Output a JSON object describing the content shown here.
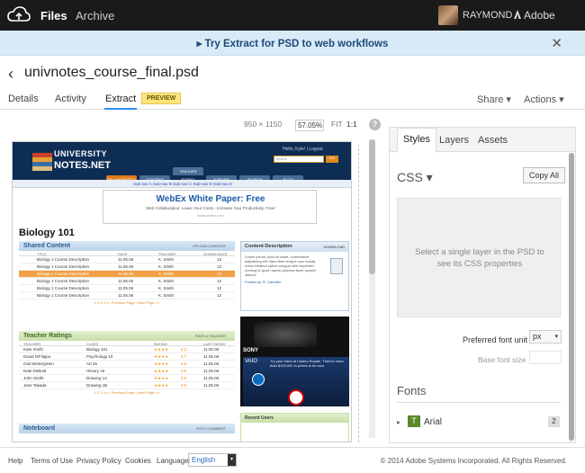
{
  "topbar": {
    "files": "Files",
    "archive": "Archive",
    "user": "RAYMOND",
    "brand": "Adobe"
  },
  "promo": {
    "text": "▸ Try Extract for PSD to web workflows",
    "close": "✕"
  },
  "file": {
    "back": "‹",
    "name": "univnotes_course_final.psd"
  },
  "tabs": {
    "details": "Details",
    "activity": "Activity",
    "extract": "Extract",
    "preview": "PREVIEW",
    "share": "Share ▾",
    "actions": "Actions ▾"
  },
  "zoom": {
    "dims": "950 × 1150",
    "value": "57.05%",
    "fit": "FIT",
    "one": "1:1",
    "help": "?"
  },
  "panel": {
    "tabs": {
      "styles": "Styles",
      "layers": "Layers",
      "assets": "Assets"
    },
    "css_title": "CSS ▾",
    "copy_all": "Copy All",
    "css_message": "Select a single layer in the PSD to see its CSS properties",
    "preferred_font_unit_label": "Preferred font unit",
    "preferred_font_unit_value": "px",
    "base_font_size_label": "Base font size",
    "fonts_title": "Fonts",
    "font_item": {
      "caret": "▸",
      "icon": "T",
      "name": "Arial",
      "count": "2"
    }
  },
  "footer": {
    "help": "Help",
    "terms": "Terms of Use",
    "privacy": "Privacy Policy",
    "cookies": "Cookies",
    "language_label": "Language:",
    "language_value": "English",
    "copyright": "© 2014 Adobe Systems Incorporated. All Rights Reserved."
  },
  "site": {
    "logo1": "UNIVERSITY",
    "logo2": "NOTES.NET",
    "hello": "Hello, Kyle! | Logout",
    "search": "search",
    "nav": [
      "MY UNIVERSITY",
      "CONTENT",
      "TEACHER RATING",
      "FORUMS",
      "SEARCH",
      "BLOG"
    ],
    "subnav": "Sub-nav A   Sub-nav B   Sub-nav C   Sub-nav D   Sub-nav E",
    "ad_title": "WebEx White Paper: Free",
    "ad_body": "Web Collaboration: Lower Your Costs - Increase Your Productivity. Free!",
    "ad_url": "www.webex.com",
    "heading": "Biology 101",
    "shared_title": "Shared Content",
    "upload": "UPLOAD CONTENT",
    "shared_cols": [
      "TITLE",
      "DATE",
      "TEACHER",
      "DOWNLOADS"
    ],
    "shared_rows": [
      [
        "Biology 1 Course Description",
        "11.05.06",
        "K. Smith",
        "12"
      ],
      [
        "Biology 1 Course Description",
        "11.05.06",
        "K. Smith",
        "12"
      ],
      [
        "Biology 1 Course Description",
        "11.05.06",
        "K. Smith",
        "12"
      ],
      [
        "Biology 1 Course Description",
        "11.05.06",
        "K. Smith",
        "12"
      ],
      [
        "Biology 1 Course Description",
        "11.05.06",
        "K. Smith",
        "12"
      ],
      [
        "Biology 1 Course Description",
        "11.05.06",
        "K. Smith",
        "12"
      ]
    ],
    "pager": "1 2 3 4      << Previous Page  |  Next Page >>",
    "ratings_title": "Teacher Ratings",
    "rate": "RATE A TEACHER",
    "ratings_cols": [
      "TEACHER",
      "CLASS",
      "RATING",
      "LAST RATED"
    ],
    "ratings_rows": [
      [
        "Kate Smith",
        "Biology 101",
        "4.2",
        "11.05.06"
      ],
      [
        "David DiFilippo",
        "Psychology 10",
        "3.7",
        "11.05.06"
      ],
      [
        "Gail Wintergreen",
        "Art 25",
        "3.6",
        "11.05.06"
      ],
      [
        "Dale DeBold",
        "History 18",
        "3.6",
        "11.05.06"
      ],
      [
        "John Smith",
        "Drawing 1A",
        "3.5",
        "11.05.06"
      ],
      [
        "Jane Takada",
        "Drawing 1B",
        "3.5",
        "11.05.06"
      ]
    ],
    "noteboard_title": "Noteboard",
    "post": "POST COMMENT",
    "content_desc_title": "Content Description",
    "download": "DOWNLOAD",
    "content_desc": "Lorem ipsum dolor sit amet, consectetur adipisicing elit. Nam liber tempor cum soluta nobis eleifend option congue nihil imperdiet doming id quod mazim placerat facer possim assum.",
    "posted_by": "Posted by: R. Camden",
    "sony": "SONY",
    "vaio": "VAIO",
    "vaio_text": "Try your hand at Casino Royale. There's more than $100,000 in prizes to be won.",
    "recent_users": "Recent Users"
  }
}
